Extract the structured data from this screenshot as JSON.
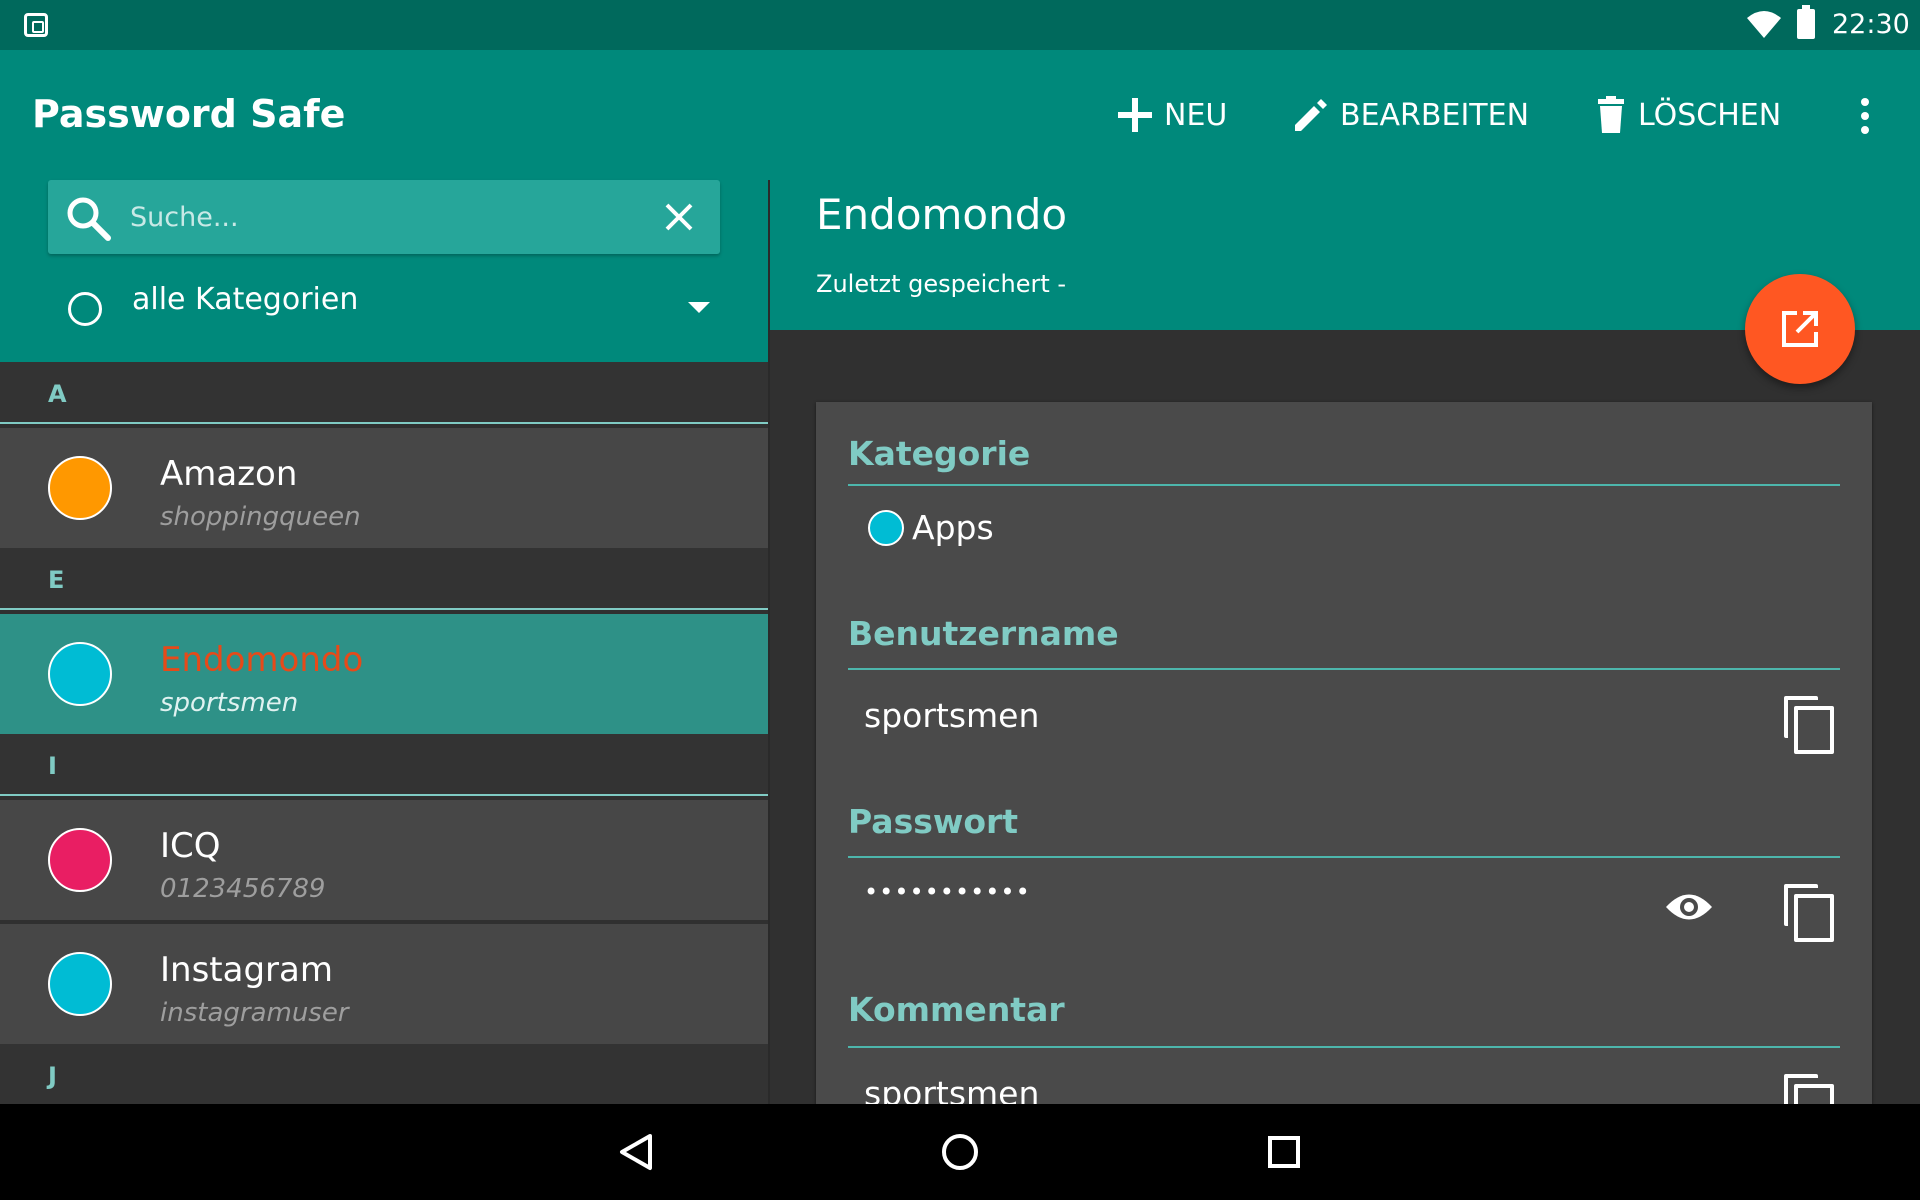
{
  "status_bar": {
    "time": "22:30",
    "icons": [
      "app-icon",
      "wifi-icon",
      "battery-icon"
    ]
  },
  "app_bar": {
    "title": "Password Safe",
    "actions": [
      {
        "label": "NEU",
        "icon": "plus-icon"
      },
      {
        "label": "BEARBEITEN",
        "icon": "pencil-icon"
      },
      {
        "label": "LÖSCHEN",
        "icon": "trash-icon"
      }
    ],
    "overflow_icon": "overflow-menu-icon"
  },
  "search": {
    "placeholder": "Suche...",
    "value": ""
  },
  "category_filter": {
    "selected": "alle Kategorien"
  },
  "list": {
    "sections": [
      {
        "letter": "A",
        "items": [
          {
            "title": "Amazon",
            "subtitle": "shoppingqueen",
            "color": "#FF9800",
            "selected": false
          }
        ]
      },
      {
        "letter": "E",
        "items": [
          {
            "title": "Endomondo",
            "subtitle": "sportsmen",
            "color": "#00BCD4",
            "selected": true
          }
        ]
      },
      {
        "letter": "I",
        "items": [
          {
            "title": "ICQ",
            "subtitle": "0123456789",
            "color": "#E91E63",
            "selected": false
          },
          {
            "title": "Instagram",
            "subtitle": "instagramuser",
            "color": "#00BCD4",
            "selected": false
          }
        ]
      },
      {
        "letter": "J",
        "items": []
      }
    ]
  },
  "detail": {
    "title": "Endomondo",
    "subtitle": "Zuletzt gespeichert -",
    "fields": {
      "category": {
        "label": "Kategorie",
        "value": "Apps",
        "color": "#00BCD4"
      },
      "username": {
        "label": "Benutzername",
        "value": "sportsmen"
      },
      "password": {
        "label": "Passwort",
        "value": "•••••••••••"
      },
      "comment": {
        "label": "Kommentar",
        "value": "sportsmen"
      }
    }
  },
  "colors": {
    "primary": "#00897B",
    "primary_dark": "#00695C",
    "accent": "#FF5722",
    "label": "#80CBC4"
  }
}
